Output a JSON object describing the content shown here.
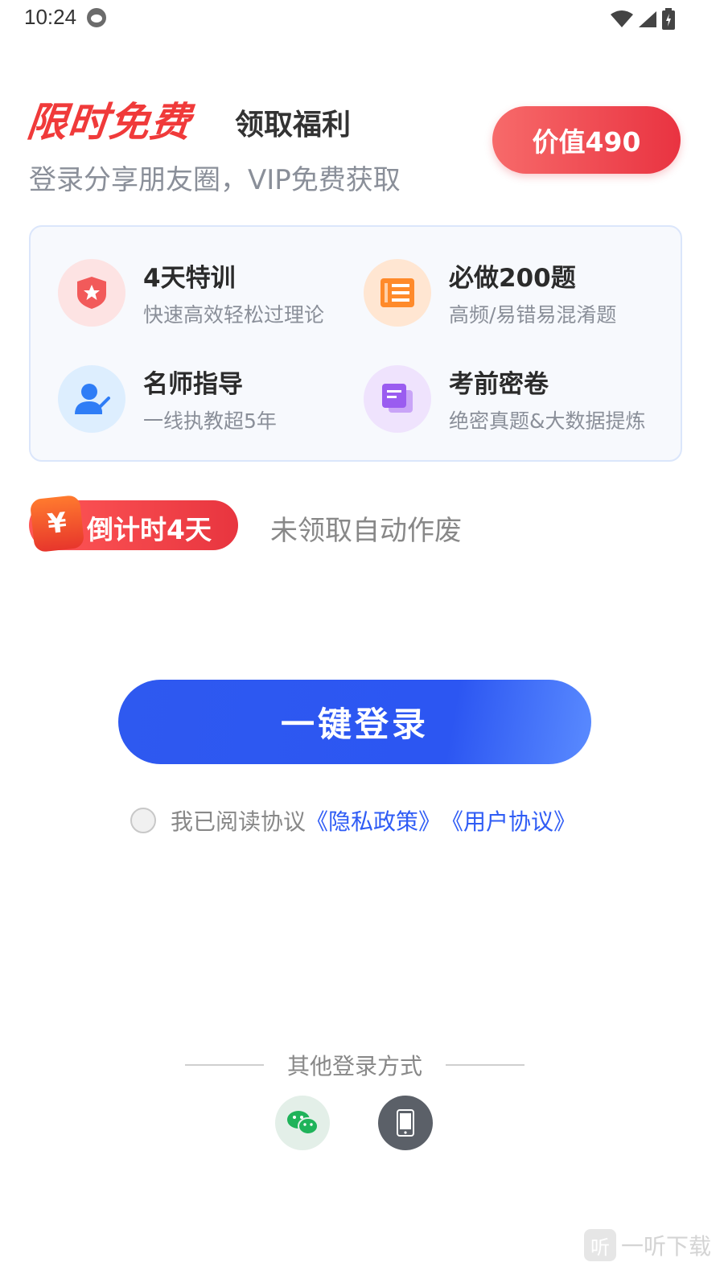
{
  "status_bar": {
    "time": "10:24"
  },
  "header": {
    "promo_title": "限时免费",
    "promo_subtitle": "领取福利",
    "description": "登录分享朋友圈，VIP免费获取",
    "value_badge": "价值490"
  },
  "benefits": [
    {
      "title": "4天特训",
      "desc": "快速高效轻松过理论",
      "icon": "shield-star-icon",
      "color": "#f25a5a"
    },
    {
      "title": "必做200题",
      "desc": "高频/易错易混淆题",
      "icon": "ticket-list-icon",
      "color": "#ff8a2a"
    },
    {
      "title": "名师指导",
      "desc": "一线执教超5年",
      "icon": "teacher-icon",
      "color": "#2f7df6"
    },
    {
      "title": "考前密卷",
      "desc": "绝密真题&大数据提炼",
      "icon": "exam-paper-icon",
      "color": "#9a5cf0"
    }
  ],
  "countdown": {
    "yuan": "¥",
    "text": "倒计时4天",
    "note": "未领取自动作废"
  },
  "login": {
    "button_label": "一键登录"
  },
  "agreement": {
    "prefix": "我已阅读协议",
    "privacy_link": "《隐私政策》",
    "user_link": "《用户协议》"
  },
  "other_login": {
    "label": "其他登录方式",
    "methods": [
      "wechat-icon",
      "phone-icon"
    ]
  },
  "watermark": {
    "logo": "听",
    "text": "一听下载"
  }
}
